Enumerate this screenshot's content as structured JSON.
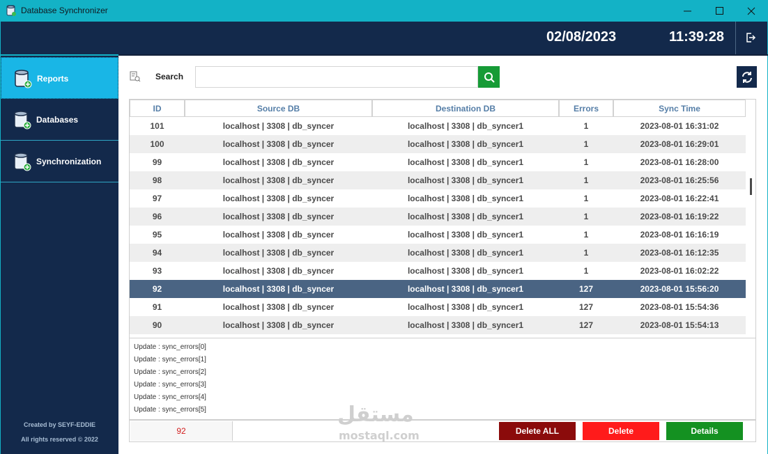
{
  "window": {
    "title": "Database Synchronizer"
  },
  "header": {
    "date": "02/08/2023",
    "time": "11:39:28"
  },
  "sidebar": {
    "items": [
      {
        "label": "Reports",
        "icon": "database-icon",
        "active": true
      },
      {
        "label": "Databases",
        "icon": "database-icon",
        "active": false
      },
      {
        "label": "Synchronization",
        "icon": "database-icon",
        "active": false
      }
    ],
    "credit_line1": "Created by SEYF-EDDIE",
    "credit_line2": "All rights reserved © 2022"
  },
  "search": {
    "label": "Search",
    "value": "",
    "placeholder": ""
  },
  "table": {
    "columns": [
      "ID",
      "Source DB",
      "Destination DB",
      "Errors",
      "Sync Time"
    ],
    "rows": [
      [
        "101",
        "localhost | 3308 | db_syncer",
        "localhost | 3308 | db_syncer1",
        "1",
        "2023-08-01 16:31:02"
      ],
      [
        "100",
        "localhost | 3308 | db_syncer",
        "localhost | 3308 | db_syncer1",
        "1",
        "2023-08-01 16:29:01"
      ],
      [
        "99",
        "localhost | 3308 | db_syncer",
        "localhost | 3308 | db_syncer1",
        "1",
        "2023-08-01 16:28:00"
      ],
      [
        "98",
        "localhost | 3308 | db_syncer",
        "localhost | 3308 | db_syncer1",
        "1",
        "2023-08-01 16:25:56"
      ],
      [
        "97",
        "localhost | 3308 | db_syncer",
        "localhost | 3308 | db_syncer1",
        "1",
        "2023-08-01 16:22:41"
      ],
      [
        "96",
        "localhost | 3308 | db_syncer",
        "localhost | 3308 | db_syncer1",
        "1",
        "2023-08-01 16:19:22"
      ],
      [
        "95",
        "localhost | 3308 | db_syncer",
        "localhost | 3308 | db_syncer1",
        "1",
        "2023-08-01 16:16:19"
      ],
      [
        "94",
        "localhost | 3308 | db_syncer",
        "localhost | 3308 | db_syncer1",
        "1",
        "2023-08-01 16:12:35"
      ],
      [
        "93",
        "localhost | 3308 | db_syncer",
        "localhost | 3308 | db_syncer1",
        "1",
        "2023-08-01 16:02:22"
      ],
      [
        "92",
        "localhost | 3308 | db_syncer",
        "localhost | 3308 | db_syncer1",
        "127",
        "2023-08-01 15:56:20"
      ],
      [
        "91",
        "localhost | 3308 | db_syncer",
        "localhost | 3308 | db_syncer1",
        "127",
        "2023-08-01 15:54:36"
      ],
      [
        "90",
        "localhost | 3308 | db_syncer",
        "localhost | 3308 | db_syncer1",
        "127",
        "2023-08-01 15:54:13"
      ]
    ],
    "selected_id": "92"
  },
  "log": {
    "lines": [
      "Update : sync_errors[0]",
      "Update : sync_errors[1]",
      "Update : sync_errors[2]",
      "Update : sync_errors[3]",
      "Update : sync_errors[4]",
      "Update : sync_errors[5]"
    ]
  },
  "footer": {
    "selected_id": "92",
    "delete_all_label": "Delete ALL",
    "delete_label": "Delete",
    "details_label": "Details"
  },
  "watermark": {
    "arabic": "مستقل",
    "latin": "mostaql.com"
  }
}
